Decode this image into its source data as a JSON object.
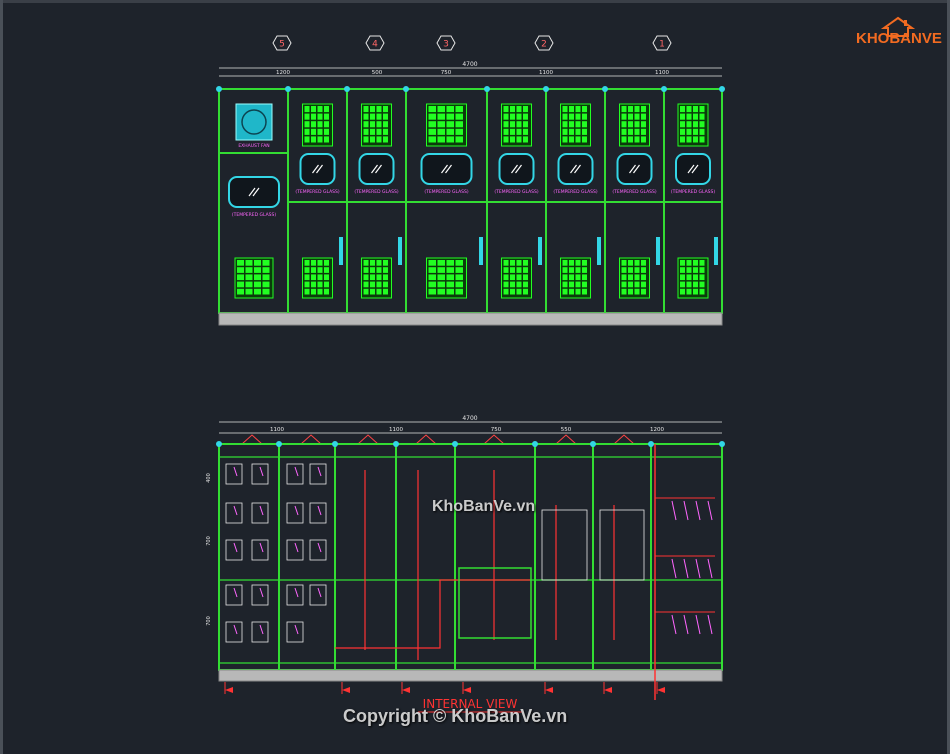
{
  "logo": {
    "text": "KHOBANVE",
    "accent": "#f26b21",
    "secondary": "#ffffff"
  },
  "watermarks": {
    "middle": "KhoBanVe.vn",
    "bottom": "Copyright © KhoBanVe.vn"
  },
  "front_view": {
    "section_markers": [
      "5",
      "4",
      "3",
      "2",
      "1"
    ],
    "overall_dim": "4700",
    "panel_dims": [
      "1200",
      "500",
      "750",
      "1100",
      "1100"
    ],
    "fan_label": "EXHAUST FAN",
    "glass_label": "(TEMPERED GLASS)"
  },
  "internal_view": {
    "overall_dim": "4700",
    "panel_dims": [
      "1100",
      "1100",
      "750",
      "550",
      "1200"
    ],
    "title": "INTERNAL VIEW",
    "row_dims": [
      "400",
      "700",
      "700"
    ]
  },
  "colors": {
    "background": "#1e232b",
    "frame": "#33dd33",
    "vent": "#22ff22",
    "glass": "#33d6e6",
    "dims": "#e6e6e6",
    "text": "#ff66ff",
    "wire": "#ff3333",
    "marker": "#ff4444"
  }
}
